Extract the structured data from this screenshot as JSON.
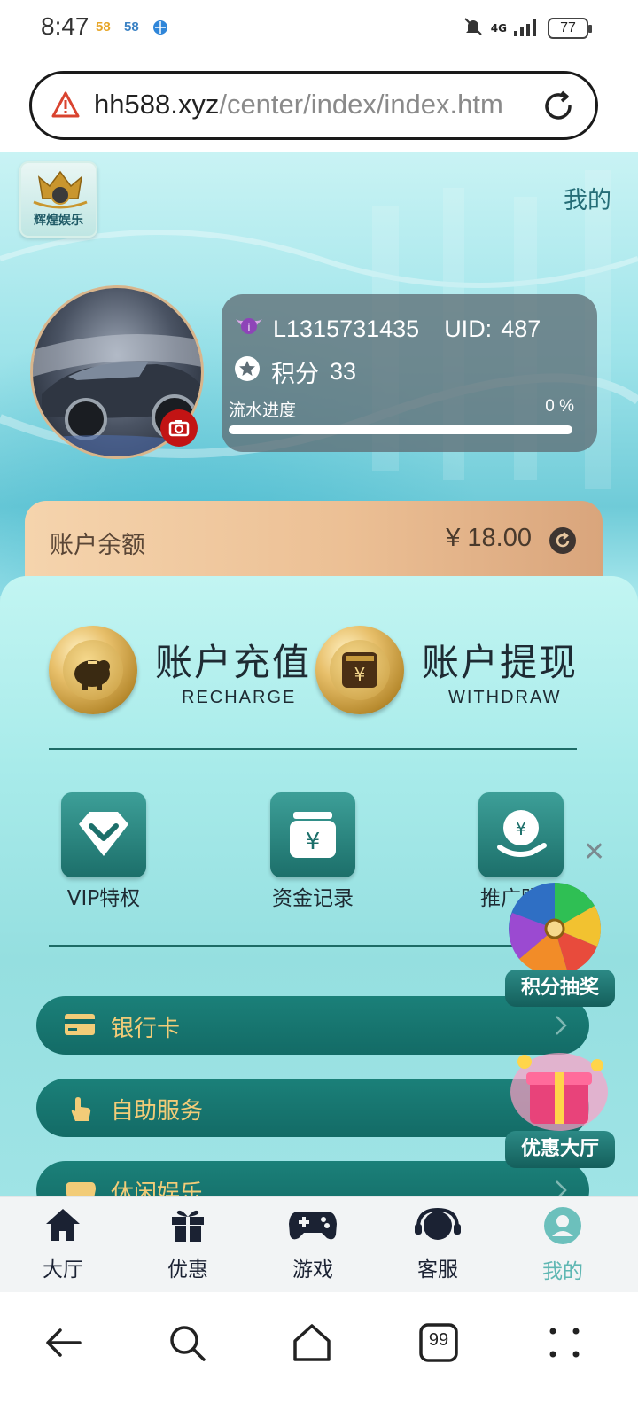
{
  "status_bar": {
    "time": "8:47",
    "notif_1": "58",
    "notif_2": "58",
    "network": "4G",
    "battery": "77"
  },
  "url_bar": {
    "host": "hh588.xyz",
    "path": "/center/index/index.htm"
  },
  "header": {
    "logo_text": "辉煌娱乐",
    "page_title": "我的"
  },
  "user": {
    "username": "L1315731435",
    "uid_label": "UID:",
    "uid_value": "487",
    "points_label": "积分",
    "points_value": "33",
    "progress_label": "流水进度",
    "progress_pct": "0 %",
    "progress_value": 0
  },
  "balance": {
    "label": "账户余额",
    "amount": "¥ 18.00"
  },
  "actions": [
    {
      "cn": "账户充值",
      "en": "RECHARGE"
    },
    {
      "cn": "账户提现",
      "en": "WITHDRAW"
    }
  ],
  "quick_links": [
    {
      "label": "VIP特权"
    },
    {
      "label": "资金记录"
    },
    {
      "label": "推广赚钱"
    }
  ],
  "menu": [
    {
      "label": "银行卡"
    },
    {
      "label": "自助服务"
    },
    {
      "label": "休闲娱乐"
    }
  ],
  "floating": {
    "wheel_caption": "积分抽奖",
    "promo_caption": "优惠大厅"
  },
  "tabs": [
    {
      "label": "大厅",
      "icon": "home-icon"
    },
    {
      "label": "优惠",
      "icon": "gift-icon"
    },
    {
      "label": "游戏",
      "icon": "gamepad-icon"
    },
    {
      "label": "客服",
      "icon": "headset-icon"
    },
    {
      "label": "我的",
      "icon": "user-icon",
      "active": true
    }
  ],
  "system_nav": {
    "tabs_count": "99"
  },
  "colors": {
    "teal_dark": "#136b66",
    "gold_text": "#f2cc78",
    "tab_active": "#5fb7b3",
    "balance_bg": "#ecc095"
  }
}
